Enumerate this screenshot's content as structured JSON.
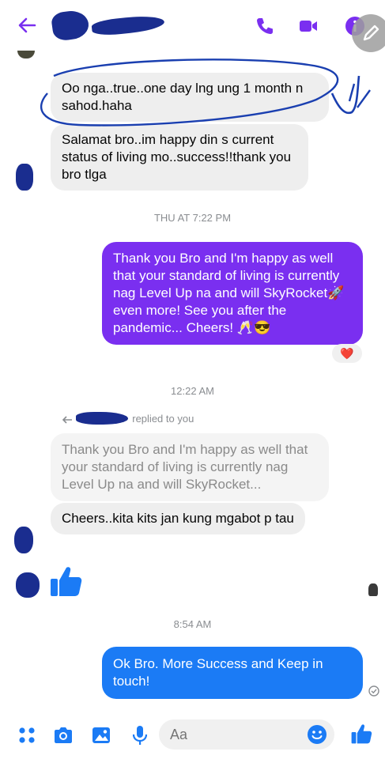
{
  "header": {
    "back_icon": "arrow-left-icon",
    "contact_name_redacted": true,
    "call_icon": "phone-icon",
    "video_icon": "video-camera-icon",
    "info_icon": "info-icon",
    "accent_color": "#7a2ff0"
  },
  "messages": {
    "m1": "Oo nga..true..one day lng ung 1 month n sahod.haha",
    "m2": "Salamat bro..im happy din s current status of living mo..success!!thank you bro tlga",
    "ts1": "THU AT 7:22 PM",
    "m3": "Thank you Bro and I'm happy as well that your standard of living is currently nag Level Up na and will SkyRocket🚀 even more! See you after the pandemic... Cheers! 🥂😎",
    "m3_reaction": "❤️",
    "ts2": "12:22 AM",
    "reply_label": "replied to you",
    "quoted": "Thank you Bro and I'm happy as well that your standard of living is currently nag Level Up na and will SkyRocket...",
    "m4": "Cheers..kita kits jan kung mgabot p tau",
    "thumbs_up": "thumbs-up-icon",
    "ts3": "8:54 AM",
    "m5": "Ok Bro. More Success and Keep in touch!"
  },
  "composer": {
    "placeholder": "Aa",
    "icons": [
      "menu-dots-icon",
      "camera-icon",
      "image-icon",
      "microphone-icon",
      "emoji-icon",
      "thumbs-up-icon"
    ]
  },
  "colors": {
    "sent_purple": "#7a2ff0",
    "sent_blue": "#1b7bf5",
    "received_gray": "#eeeeee",
    "annotation_blue": "#1a3fb0"
  }
}
